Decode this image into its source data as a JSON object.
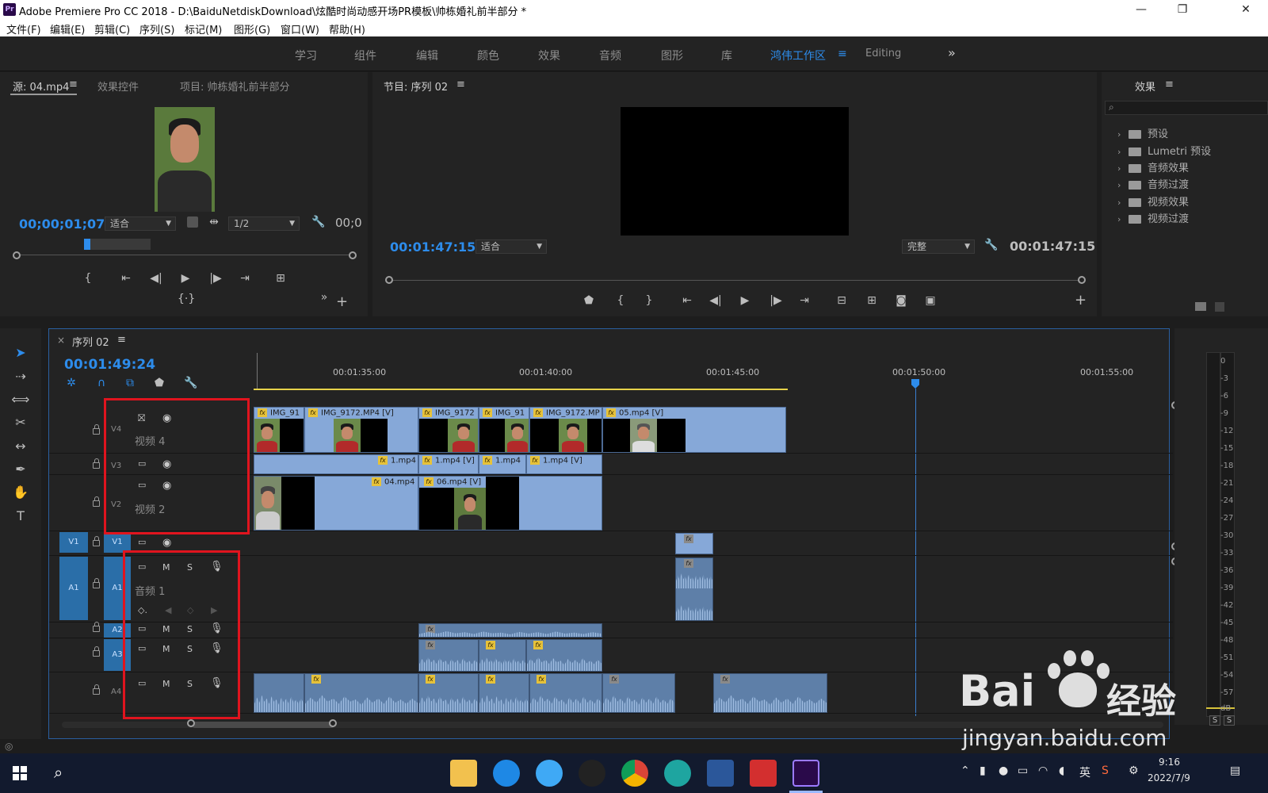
{
  "window": {
    "app_icon": "Pr",
    "title": "Adobe Premiere Pro CC 2018 - D:\\BaiduNetdiskDownload\\炫酷时尚动感开场PR模板\\帅栋婚礼前半部分 *",
    "minimize": "—",
    "maximize": "❐",
    "close": "✕"
  },
  "menu": [
    "文件(F)",
    "编辑(E)",
    "剪辑(C)",
    "序列(S)",
    "标记(M)",
    "图形(G)",
    "窗口(W)",
    "帮助(H)"
  ],
  "workspaces": {
    "tabs": [
      "学习",
      "组件",
      "编辑",
      "颜色",
      "效果",
      "音频",
      "图形",
      "库",
      "鸿伟工作区",
      "Editing"
    ],
    "active": "鸿伟工作区",
    "menu_icon": "≡",
    "overflow": "»"
  },
  "source_panel": {
    "tabs": [
      "源: 04.mp4",
      "效果控件",
      "项目: 帅栋婚礼前半部分"
    ],
    "menu_icon": "≡",
    "timecode": "00;00;01;07",
    "fit": "适合",
    "resolution": "1/2",
    "timecode_right": "00;0"
  },
  "program_panel": {
    "tab": "节目: 序列 02",
    "menu_icon": "≡",
    "timecode": "00:01:47:15",
    "fit": "适合",
    "quality": "完整",
    "duration": "00:01:47:15"
  },
  "effects_panel": {
    "tab": "效果",
    "menu_icon": "≡",
    "items": [
      "预设",
      "Lumetri 预设",
      "音频效果",
      "音频过渡",
      "视频效果",
      "视频过渡"
    ]
  },
  "timeline": {
    "close": "×",
    "tab": "序列 02",
    "menu_icon": "≡",
    "timecode": "00:01:49:24",
    "ruler": [
      "00:01:35:00",
      "00:01:40:00",
      "00:01:45:00",
      "00:01:50:00",
      "00:01:55:00"
    ],
    "tracks": {
      "v4": {
        "id": "V4",
        "name": "视频 4"
      },
      "v3": {
        "id": "V3"
      },
      "v2": {
        "id": "V2",
        "name": "视频 2"
      },
      "v1": {
        "id": "V1",
        "source": "V1"
      },
      "a1": {
        "id": "A1",
        "source": "A1",
        "name": "音频 1"
      },
      "a2": {
        "id": "A2"
      },
      "a3": {
        "id": "A3"
      },
      "a4": {
        "id": "A4"
      }
    },
    "track_buttons": {
      "mute": "M",
      "solo": "S"
    },
    "clips_v4": [
      "IMG_91",
      "IMG_9172.MP4 [V]",
      "IMG_9172",
      "IMG_91",
      "IMG_9172.MP",
      "05.mp4 [V]"
    ],
    "clips_v3": [
      "1.mp4",
      "1.mp4 [V]",
      "1.mp4",
      "1.mp4 [V]"
    ],
    "clips_v2": [
      "04.mp4",
      "06.mp4 [V]"
    ],
    "fx_label": "fx"
  },
  "meter": {
    "db": [
      "0",
      "-3",
      "-6",
      "-9",
      "-12",
      "-15",
      "-18",
      "-21",
      "-24",
      "-27",
      "-30",
      "-33",
      "-36",
      "-39",
      "-42",
      "-45",
      "-48",
      "-51",
      "-54",
      "-57",
      "dB"
    ],
    "solo": [
      "S",
      "S"
    ]
  },
  "taskbar": {
    "ime": "英",
    "time": "9:16",
    "date": "2022/7/9"
  },
  "watermark": {
    "brand": "Bai",
    "brand2": "经验",
    "url": "jingyan.baidu.com"
  },
  "colors": {
    "accent": "#2d8ceb",
    "highlight": "#e0141e",
    "clip_video": "#86a8d8",
    "clip_audio": "#5e7fa8"
  }
}
